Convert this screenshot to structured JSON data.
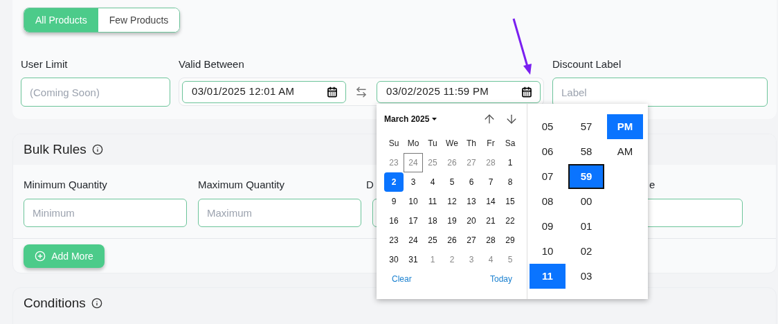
{
  "scope_toggle": [
    {
      "label": "All Products",
      "selected": true
    },
    {
      "label": "Few Products",
      "selected": false
    }
  ],
  "general": {
    "user_limit": {
      "label": "User Limit",
      "placeholder": "(Coming Soon)"
    },
    "valid_between": {
      "label": "Valid Between",
      "start": {
        "value": "03/01/2025 12:01 AM"
      },
      "end": {
        "value": "03/02/2025 11:59 PM"
      }
    },
    "discount_label": {
      "label": "Discount Label",
      "placeholder": "Label"
    }
  },
  "bulk_rules": {
    "title": "Bulk Rules",
    "fields": [
      {
        "label": "Minimum Quantity",
        "placeholder": "Minimum"
      },
      {
        "label": "Maximum Quantity",
        "placeholder": "Maximum"
      },
      {
        "label": "D"
      },
      {
        "label": "e"
      }
    ],
    "add_button": "Add More"
  },
  "conditions": {
    "title": "Conditions"
  },
  "date_picker": {
    "month_label": "March 2025",
    "weekdays": [
      "Su",
      "Mo",
      "Tu",
      "We",
      "Th",
      "Fr",
      "Sa"
    ],
    "days": [
      {
        "day": "23",
        "outside": true,
        "selected": false,
        "current": false
      },
      {
        "day": "24",
        "outside": true,
        "selected": false,
        "current": true
      },
      {
        "day": "25",
        "outside": true,
        "selected": false,
        "current": false
      },
      {
        "day": "26",
        "outside": true,
        "selected": false,
        "current": false
      },
      {
        "day": "27",
        "outside": true,
        "selected": false,
        "current": false
      },
      {
        "day": "28",
        "outside": true,
        "selected": false,
        "current": false
      },
      {
        "day": "1",
        "outside": false,
        "selected": false,
        "current": false
      },
      {
        "day": "2",
        "outside": false,
        "selected": true,
        "current": false
      },
      {
        "day": "3",
        "outside": false,
        "selected": false,
        "current": false
      },
      {
        "day": "4",
        "outside": false,
        "selected": false,
        "current": false
      },
      {
        "day": "5",
        "outside": false,
        "selected": false,
        "current": false
      },
      {
        "day": "6",
        "outside": false,
        "selected": false,
        "current": false
      },
      {
        "day": "7",
        "outside": false,
        "selected": false,
        "current": false
      },
      {
        "day": "8",
        "outside": false,
        "selected": false,
        "current": false
      },
      {
        "day": "9",
        "outside": false,
        "selected": false,
        "current": false
      },
      {
        "day": "10",
        "outside": false,
        "selected": false,
        "current": false
      },
      {
        "day": "11",
        "outside": false,
        "selected": false,
        "current": false
      },
      {
        "day": "12",
        "outside": false,
        "selected": false,
        "current": false
      },
      {
        "day": "13",
        "outside": false,
        "selected": false,
        "current": false
      },
      {
        "day": "14",
        "outside": false,
        "selected": false,
        "current": false
      },
      {
        "day": "15",
        "outside": false,
        "selected": false,
        "current": false
      },
      {
        "day": "16",
        "outside": false,
        "selected": false,
        "current": false
      },
      {
        "day": "17",
        "outside": false,
        "selected": false,
        "current": false
      },
      {
        "day": "18",
        "outside": false,
        "selected": false,
        "current": false
      },
      {
        "day": "19",
        "outside": false,
        "selected": false,
        "current": false
      },
      {
        "day": "20",
        "outside": false,
        "selected": false,
        "current": false
      },
      {
        "day": "21",
        "outside": false,
        "selected": false,
        "current": false
      },
      {
        "day": "22",
        "outside": false,
        "selected": false,
        "current": false
      },
      {
        "day": "23",
        "outside": false,
        "selected": false,
        "current": false
      },
      {
        "day": "24",
        "outside": false,
        "selected": false,
        "current": false
      },
      {
        "day": "25",
        "outside": false,
        "selected": false,
        "current": false
      },
      {
        "day": "26",
        "outside": false,
        "selected": false,
        "current": false
      },
      {
        "day": "27",
        "outside": false,
        "selected": false,
        "current": false
      },
      {
        "day": "28",
        "outside": false,
        "selected": false,
        "current": false
      },
      {
        "day": "29",
        "outside": false,
        "selected": false,
        "current": false
      },
      {
        "day": "30",
        "outside": false,
        "selected": false,
        "current": false
      },
      {
        "day": "31",
        "outside": false,
        "selected": false,
        "current": false
      },
      {
        "day": "1",
        "outside": true,
        "selected": false,
        "current": false
      },
      {
        "day": "2",
        "outside": true,
        "selected": false,
        "current": false
      },
      {
        "day": "3",
        "outside": true,
        "selected": false,
        "current": false
      },
      {
        "day": "4",
        "outside": true,
        "selected": false,
        "current": false
      },
      {
        "day": "5",
        "outside": true,
        "selected": false,
        "current": false
      }
    ],
    "clear_button": "Clear",
    "today_button": "Today",
    "hours": [
      {
        "label": "05",
        "selected": false
      },
      {
        "label": "06",
        "selected": false
      },
      {
        "label": "07",
        "selected": false
      },
      {
        "label": "08",
        "selected": false
      },
      {
        "label": "09",
        "selected": false
      },
      {
        "label": "10",
        "selected": false
      },
      {
        "label": "11",
        "selected": true
      }
    ],
    "minutes": [
      {
        "label": "57",
        "selected": false,
        "focused": false
      },
      {
        "label": "58",
        "selected": false,
        "focused": false
      },
      {
        "label": "59",
        "selected": true,
        "focused": true
      },
      {
        "label": "00",
        "selected": false,
        "focused": false
      },
      {
        "label": "01",
        "selected": false,
        "focused": false
      },
      {
        "label": "02",
        "selected": false,
        "focused": false
      },
      {
        "label": "03",
        "selected": false,
        "focused": false
      }
    ],
    "periods": [
      {
        "label": "PM",
        "selected": true
      },
      {
        "label": "AM",
        "selected": false
      }
    ]
  }
}
